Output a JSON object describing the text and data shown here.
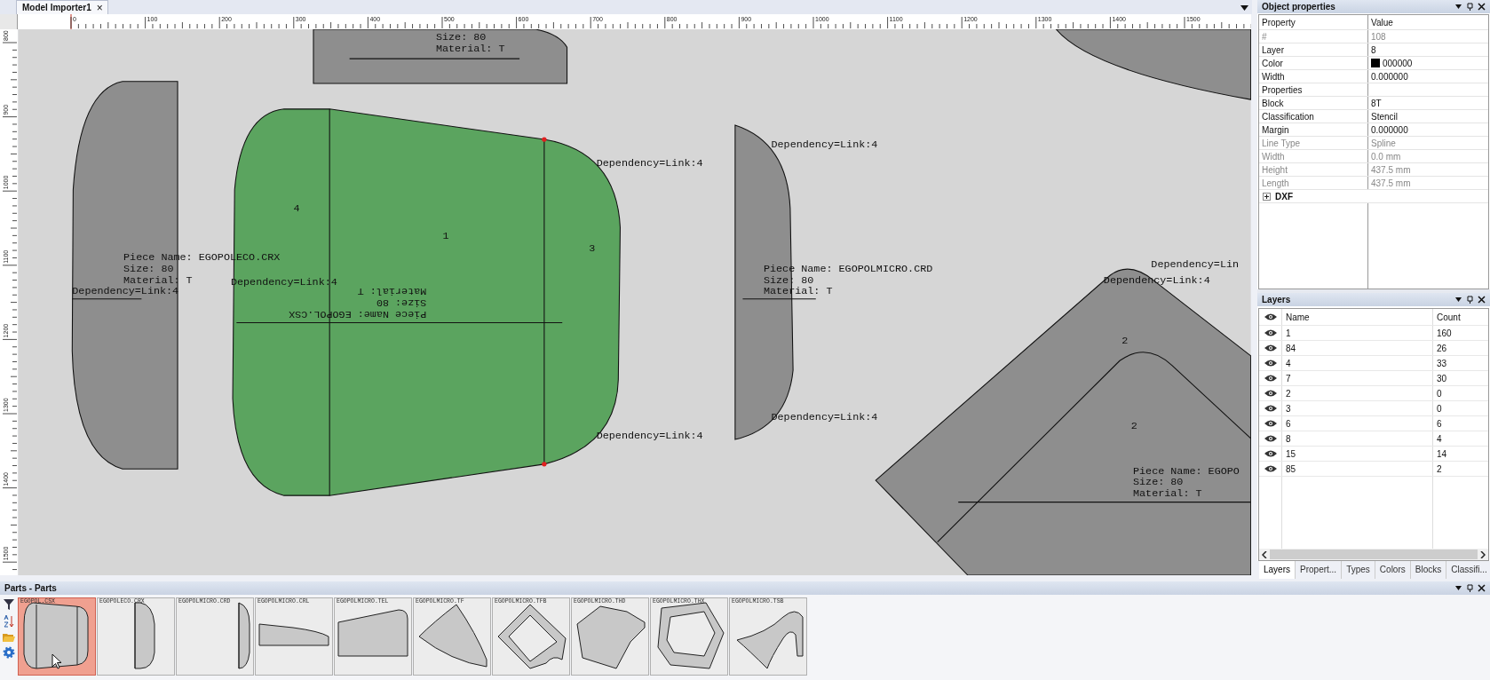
{
  "document_tab": {
    "title": "Model Importer1",
    "close": "×"
  },
  "ruler": {
    "top_labels": [
      "0",
      "100",
      "200",
      "300",
      "400",
      "500",
      "600",
      "700",
      "800",
      "900",
      "1000",
      "1100",
      "1200",
      "1300",
      "1400",
      "1500"
    ],
    "left_labels": [
      "800",
      "900",
      "1000",
      "1100",
      "1200",
      "1300",
      "1400",
      "1500"
    ]
  },
  "canvas": {
    "pieces": [
      {
        "selected": false,
        "labels": [
          "Size: 80",
          "Material: T"
        ]
      },
      {
        "selected": false,
        "labels": [
          "Piece Name: EGOPOLECO.CRX",
          "Size: 80",
          "Material: T",
          "Dependency=Link:4"
        ]
      },
      {
        "selected": true,
        "labels": [
          "Dependency=Link:4",
          "4",
          "1",
          "3",
          "Dependency=Link:4",
          "Material: T",
          "Size: 80",
          "Piece Name: EGOPOL.CSX",
          "Dependency=Link:4"
        ]
      },
      {
        "selected": false,
        "labels": [
          "Dependency=Link:4",
          "Piece Name: EGOPOLMICRO.CRD",
          "Size: 80",
          "Material: T",
          "Dependency=Link:4"
        ]
      },
      {
        "selected": false,
        "labels": [
          "Dependency=Lin",
          "Dependency=Link:4",
          "2",
          "2",
          "Piece Name: EGOPO",
          "Size: 80",
          "Material: T"
        ]
      },
      {
        "selected": false
      }
    ]
  },
  "object_properties": {
    "title": "Object properties",
    "columns": [
      "Property",
      "Value"
    ],
    "rows": [
      {
        "property": "#",
        "value": "108",
        "disabled": true
      },
      {
        "property": "Layer",
        "value": "8",
        "disabled": false
      },
      {
        "property": "Color",
        "value": "000000",
        "disabled": false,
        "color": "#000000"
      },
      {
        "property": "Width",
        "value": "0.000000",
        "disabled": false
      },
      {
        "property": "Properties",
        "disabled": false
      },
      {
        "property": "Block",
        "value": "8T",
        "disabled": false
      },
      {
        "property": "Classification",
        "value": "Stencil",
        "disabled": false
      },
      {
        "property": "Margin",
        "value": "0.000000",
        "disabled": false
      },
      {
        "property": "Line Type",
        "value": "Spline",
        "disabled": true
      },
      {
        "property": "Width",
        "value": "0.0 mm",
        "disabled": true
      },
      {
        "property": "Height",
        "value": "437.5 mm",
        "disabled": true
      },
      {
        "property": "Length",
        "value": "437.5 mm",
        "disabled": true
      }
    ],
    "group": {
      "label": "DXF",
      "expanded": false
    }
  },
  "layers": {
    "title": "Layers",
    "columns": [
      "Name",
      "Count"
    ],
    "rows": [
      {
        "name": "1",
        "count": "160",
        "visible": true
      },
      {
        "name": "84",
        "count": "26",
        "visible": true
      },
      {
        "name": "4",
        "count": "33",
        "visible": true
      },
      {
        "name": "7",
        "count": "30",
        "visible": true
      },
      {
        "name": "2",
        "count": "0",
        "visible": true
      },
      {
        "name": "3",
        "count": "0",
        "visible": true
      },
      {
        "name": "6",
        "count": "6",
        "visible": true
      },
      {
        "name": "8",
        "count": "4",
        "visible": true
      },
      {
        "name": "15",
        "count": "14",
        "visible": true
      },
      {
        "name": "85",
        "count": "2",
        "visible": true
      }
    ],
    "tabs": [
      {
        "label": "Layers",
        "selected": true
      },
      {
        "label": "Propert...",
        "selected": false
      },
      {
        "label": "Types",
        "selected": false
      },
      {
        "label": "Colors",
        "selected": false
      },
      {
        "label": "Blocks",
        "selected": false
      },
      {
        "label": "Classifi...",
        "selected": false
      }
    ]
  },
  "parts": {
    "title": "Parts - Parts",
    "items": [
      {
        "name": "EGOPOL.CSX",
        "selected": true
      },
      {
        "name": "EGOPOLECO.CRX",
        "selected": false
      },
      {
        "name": "EGOPOLMICRO.CRD",
        "selected": false
      },
      {
        "name": "EGOPOLMICRO.CRL",
        "selected": false
      },
      {
        "name": "EGOPOLMICRO.TEL",
        "selected": false
      },
      {
        "name": "EGOPOLMICRO.TF",
        "selected": false
      },
      {
        "name": "EGOPOLMICRO.TFB",
        "selected": false
      },
      {
        "name": "EGOPOLMICRO.THD",
        "selected": false
      },
      {
        "name": "EGOPOLMICRO.THX",
        "selected": false
      },
      {
        "name": "EGOPOLMICRO.TSB",
        "selected": false
      }
    ]
  }
}
